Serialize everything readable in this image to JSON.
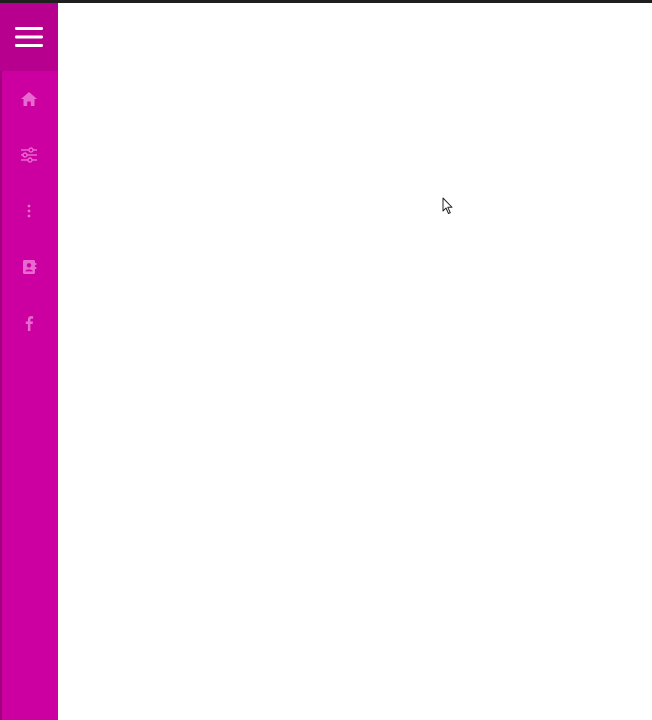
{
  "theme": {
    "sidebar_color": "#cc00a0",
    "sidebar_header_color": "#b8008f",
    "icon_color": "#e86ad0",
    "content_color": "#ffffff"
  },
  "sidebar": {
    "menu_icon": "hamburger-menu-icon",
    "items": [
      {
        "icon": "home-icon",
        "label": ""
      },
      {
        "icon": "sliders-icon",
        "label": ""
      },
      {
        "icon": "more-vertical-icon",
        "label": ""
      },
      {
        "icon": "contact-card-icon",
        "label": ""
      },
      {
        "icon": "facebook-icon",
        "label": ""
      }
    ]
  }
}
